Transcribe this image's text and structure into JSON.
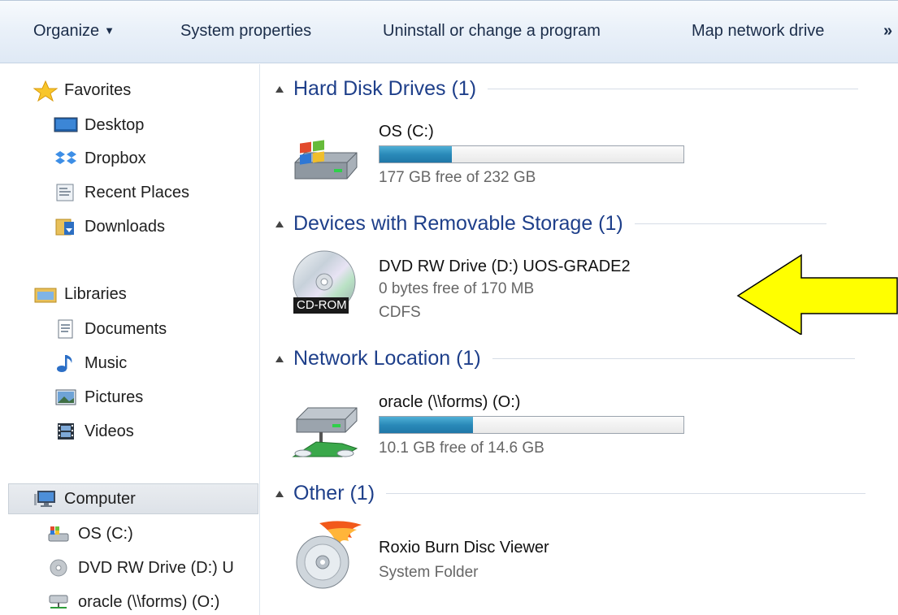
{
  "toolbar": {
    "organize": "Organize",
    "system_properties": "System properties",
    "uninstall": "Uninstall or change a program",
    "map_drive": "Map network drive",
    "more": "»"
  },
  "nav": {
    "favorites": {
      "label": "Favorites",
      "items": [
        {
          "label": "Desktop",
          "icon": "desktop-icon"
        },
        {
          "label": "Dropbox",
          "icon": "dropbox-icon"
        },
        {
          "label": "Recent Places",
          "icon": "recent-places-icon"
        },
        {
          "label": "Downloads",
          "icon": "downloads-folder-icon"
        }
      ]
    },
    "libraries": {
      "label": "Libraries",
      "items": [
        {
          "label": "Documents",
          "icon": "document-icon"
        },
        {
          "label": "Music",
          "icon": "music-note-icon"
        },
        {
          "label": "Pictures",
          "icon": "pictures-icon"
        },
        {
          "label": "Videos",
          "icon": "film-icon"
        }
      ]
    },
    "computer": {
      "label": "Computer",
      "items": [
        {
          "label": "OS (C:)",
          "icon": "hard-drive-icon"
        },
        {
          "label": "DVD RW Drive (D:) U",
          "icon": "dvd-drive-icon"
        },
        {
          "label": "oracle (\\\\forms) (O:)",
          "icon": "network-drive-icon"
        }
      ]
    }
  },
  "groups": {
    "hdd": {
      "title": "Hard Disk Drives (1)",
      "drive": {
        "name": "OS (C:)",
        "free_text": "177 GB free of 232 GB",
        "used_fraction": 0.237
      }
    },
    "removable": {
      "title": "Devices with Removable Storage (1)",
      "drive": {
        "name": "DVD RW Drive (D:) UOS-GRADE2",
        "free_text": "0 bytes free of 170 MB",
        "fs": "CDFS",
        "badge": "CD-ROM"
      }
    },
    "network": {
      "title": "Network Location (1)",
      "drive": {
        "name": "oracle (\\\\forms) (O:)",
        "free_text": "10.1 GB free of 14.6 GB",
        "used_fraction": 0.308
      }
    },
    "other": {
      "title": "Other (1)",
      "item": {
        "name": "Roxio Burn Disc Viewer",
        "sub": "System Folder"
      }
    }
  },
  "colors": {
    "group_title": "#1e3f8a",
    "bar_fill": "#2a8ab9",
    "arrow_fill": "#ffff00"
  }
}
